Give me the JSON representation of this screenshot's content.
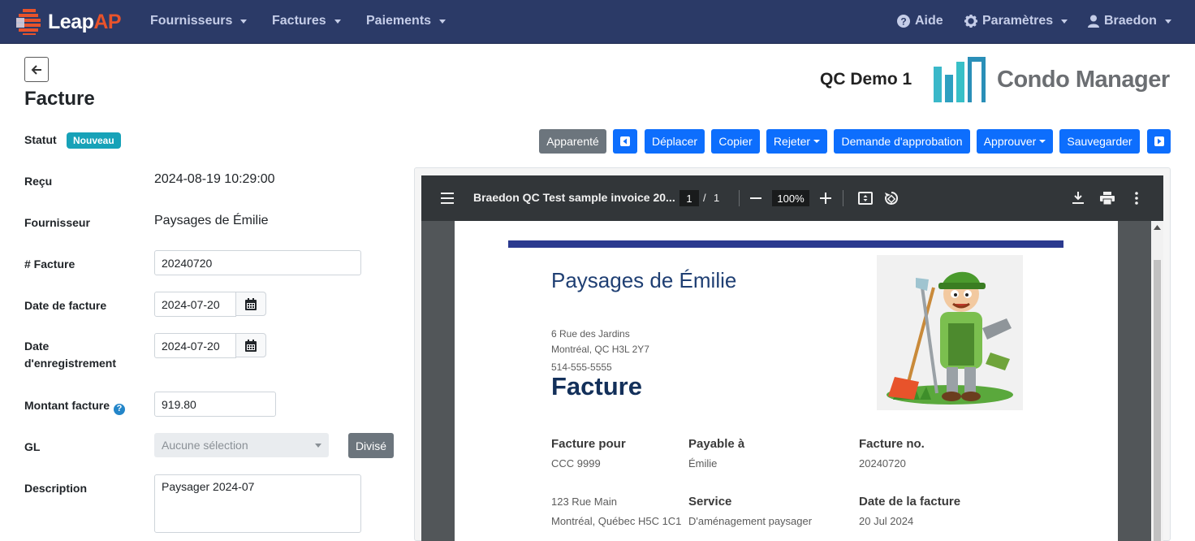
{
  "nav": {
    "brand_part1": "Leap",
    "brand_part2": "AP",
    "items": [
      "Fournisseurs",
      "Factures",
      "Paiements"
    ],
    "help": "Aide",
    "settings": "Paramètres",
    "user": "Braedon"
  },
  "header": {
    "title": "Facture",
    "client": "QC Demo 1",
    "logo_text": "Condo Manager"
  },
  "form": {
    "statut_label": "Statut",
    "statut_badge": "Nouveau",
    "recu_label": "Reçu",
    "recu_value": "2024-08-19 10:29:00",
    "fournisseur_label": "Fournisseur",
    "fournisseur_value": "Paysages de Émilie",
    "facture_no_label": "# Facture",
    "facture_no_value": "20240720",
    "date_facture_label": "Date de facture",
    "date_facture_value": "2024-07-20",
    "date_enreg_label_1": "Date",
    "date_enreg_label_2": "d'enregistrement",
    "date_enreg_value": "2024-07-20",
    "montant_label": "Montant facture",
    "montant_value": "919.80",
    "gl_label": "GL",
    "gl_placeholder": "Aucune sélection",
    "divise_button": "Divisé",
    "description_label": "Description",
    "description_value": "Paysager 2024-07"
  },
  "actions": {
    "apparente": "Apparenté",
    "deplacer": "Déplacer",
    "copier": "Copier",
    "rejeter": "Rejeter",
    "demande": "Demande d'approbation",
    "approuver": "Approuver",
    "sauvegarder": "Sauvegarder"
  },
  "viewer": {
    "file_title": "Braedon QC Test sample invoice 20...",
    "page_current": "1",
    "page_sep": "/",
    "page_total": "1",
    "zoom": "100%"
  },
  "invoice": {
    "company": "Paysages de Émilie",
    "addr1": "6 Rue des Jardins",
    "addr2": "Montréal, QC H3L 2Y7",
    "phone": "514-555-5555",
    "title": "Facture",
    "bill_to_label": "Facture pour",
    "bill_to_value": "CCC 9999",
    "bill_to_addr1": "123 Rue Main",
    "bill_to_addr2": "Montréal, Québec H5C 1C1",
    "payable_label": "Payable à",
    "payable_value": "Émilie",
    "service_label": "Service",
    "service_value": "D'aménagement paysager",
    "invoice_no_label": "Facture no.",
    "invoice_no_value": "20240720",
    "date_label": "Date de la facture",
    "date_value": "20 Jul 2024"
  },
  "colors": {
    "navbar": "#2b3a67",
    "accent_orange": "#e8532b",
    "primary_button": "#0d6efd",
    "badge": "#17a2b8",
    "invoice_band": "#2b3a8f"
  }
}
